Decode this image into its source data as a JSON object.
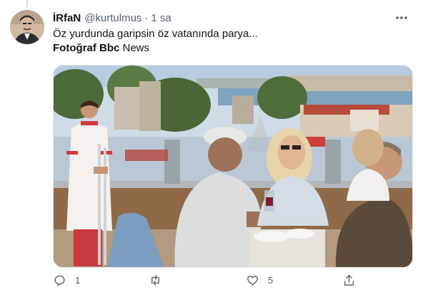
{
  "tweet": {
    "author_name": "İRfaN",
    "author_handle": "@kurtulmus",
    "separator": "·",
    "time": "1 sa",
    "text_line1": "Öz yurdunda garipsin öz vatanında parya...",
    "text_line2_bold": "Fotoğraf Bbc",
    "text_line2_rest": " News"
  },
  "actions": {
    "reply_count": "1",
    "retweet_count": "",
    "like_count": "5"
  },
  "icons": {
    "more": "more-horizontal-icon",
    "reply": "reply-icon",
    "retweet": "retweet-icon",
    "like": "heart-icon",
    "share": "share-icon"
  },
  "colors": {
    "text": "#0f1419",
    "secondary": "#536471"
  }
}
